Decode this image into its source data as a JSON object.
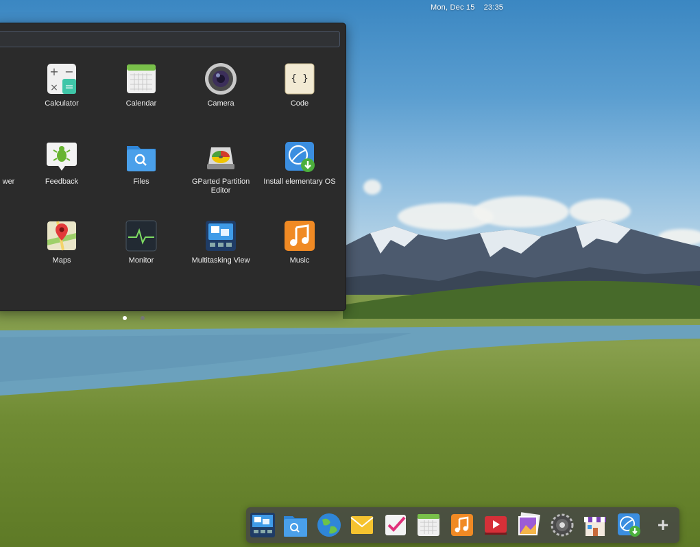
{
  "topbar": {
    "clock": "Mon, Dec 15    23:35"
  },
  "launcher": {
    "search": {
      "placeholder": ""
    },
    "apps": [
      {
        "label": "Calculator",
        "icon": "calculator-icon"
      },
      {
        "label": "Calendar",
        "icon": "calendar-icon"
      },
      {
        "label": "Camera",
        "icon": "camera-icon"
      },
      {
        "label": "Code",
        "icon": "code-icon"
      },
      {
        "label": "wer",
        "icon": ""
      },
      {
        "label": "Feedback",
        "icon": "feedback-icon"
      },
      {
        "label": "Files",
        "icon": "files-icon"
      },
      {
        "label": "GParted Partition Editor",
        "icon": "gparted-icon"
      },
      {
        "label": "Install elementary OS",
        "icon": "installer-icon"
      },
      {
        "label": "Maps",
        "icon": "maps-icon"
      },
      {
        "label": "Monitor",
        "icon": "monitor-icon"
      },
      {
        "label": "Multitasking View",
        "icon": "multitasking-icon"
      },
      {
        "label": "Music",
        "icon": "music-icon"
      }
    ],
    "pages": {
      "count": 2,
      "current": 1
    }
  },
  "dock": {
    "items": [
      "multitasking-view-icon",
      "files-icon",
      "web-browser-icon",
      "mail-icon",
      "tasks-icon",
      "calendar-icon",
      "music-icon",
      "videos-icon",
      "photos-icon",
      "system-settings-icon",
      "appcenter-icon",
      "installer-icon",
      "add-icon"
    ],
    "add_label": "+"
  },
  "colors": {
    "launcher_bg": "#2b2b2b",
    "dot_active": "#ffffff",
    "dot_inactive": "#777777"
  }
}
